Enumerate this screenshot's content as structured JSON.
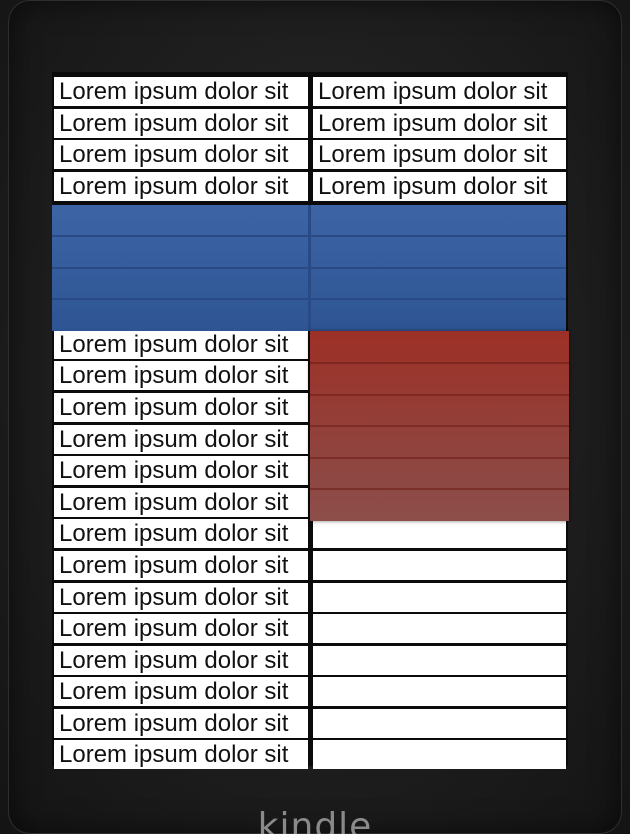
{
  "device": {
    "brand": "kindle"
  },
  "table": {
    "top_rows": [
      {
        "c1": "Lorem ipsum dolor sit",
        "c2": "Lorem ipsum dolor sit"
      },
      {
        "c1": "Lorem ipsum dolor sit",
        "c2": "Lorem ipsum dolor sit"
      },
      {
        "c1": "Lorem ipsum dolor sit",
        "c2": "Lorem ipsum dolor sit"
      },
      {
        "c1": "Lorem ipsum dolor sit",
        "c2": "Lorem ipsum dolor sit"
      }
    ],
    "lower_rows": [
      {
        "c1": "Lorem ipsum dolor sit"
      },
      {
        "c1": "Lorem ipsum dolor sit"
      },
      {
        "c1": "Lorem ipsum dolor sit"
      },
      {
        "c1": "Lorem ipsum dolor sit"
      },
      {
        "c1": "Lorem ipsum dolor sit"
      },
      {
        "c1": "Lorem ipsum dolor sit"
      },
      {
        "c1": "Lorem ipsum dolor sit"
      },
      {
        "c1": "Lorem ipsum dolor sit"
      },
      {
        "c1": "Lorem ipsum dolor sit"
      },
      {
        "c1": "Lorem ipsum dolor sit"
      },
      {
        "c1": "Lorem ipsum dolor sit"
      },
      {
        "c1": "Lorem ipsum dolor sit"
      },
      {
        "c1": "Lorem ipsum dolor sit"
      },
      {
        "c1": "Lorem ipsum dolor sit"
      }
    ]
  },
  "colors": {
    "highlight_blue": "#3d65a6",
    "highlight_red": "#9d3026"
  }
}
